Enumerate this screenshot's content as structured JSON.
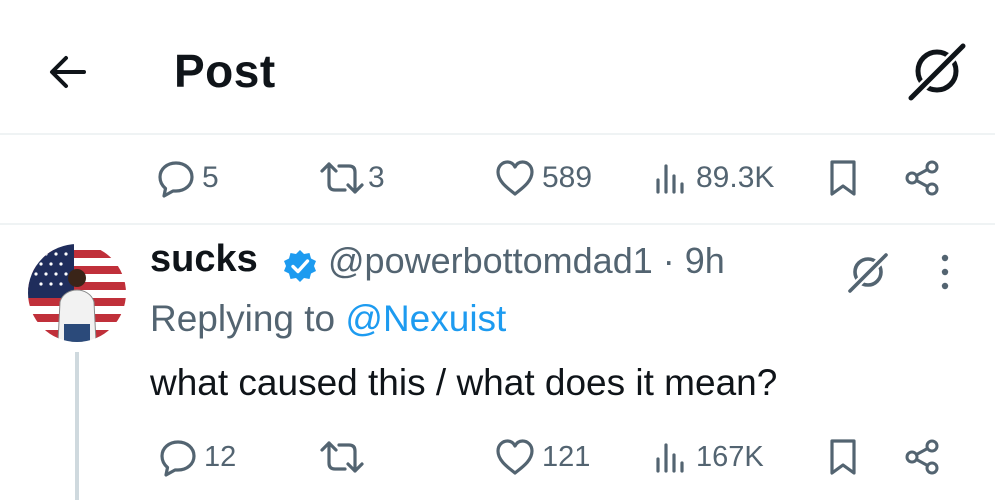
{
  "header": {
    "title": "Post"
  },
  "main_post": {
    "replies": "5",
    "reposts": "3",
    "likes": "589",
    "views": "89.3K"
  },
  "reply": {
    "author_name": "sucks",
    "author_handle": "@powerbottomdad1",
    "separator": "·",
    "time": "9h",
    "replying_prefix": "Replying to",
    "replying_mention": "@Nexuist",
    "text": "what caused this / what does it mean?",
    "replies": "12",
    "reposts": "",
    "likes": "121",
    "views": "167K"
  },
  "icons": {
    "back": "arrow-left-icon",
    "grok": "grok-icon",
    "reply": "speech-bubble-icon",
    "repost": "repost-icon",
    "like": "heart-icon",
    "views": "bar-chart-icon",
    "bookmark": "bookmark-icon",
    "share": "share-icon",
    "verified": "verified-badge-icon",
    "more": "more-vertical-icon"
  },
  "colors": {
    "text_primary": "#0f1419",
    "text_secondary": "#536471",
    "link": "#1d9bf0",
    "verified": "#1d9bf0",
    "divider": "#eff3f4"
  }
}
